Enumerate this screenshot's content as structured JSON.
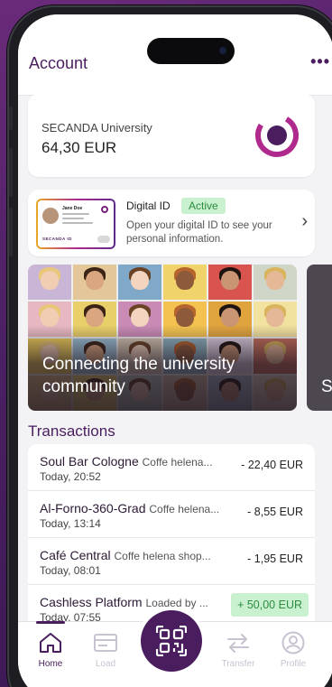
{
  "header": {
    "title": "Account",
    "more": "•••"
  },
  "balance": {
    "organization": "SECANDA University",
    "amount": "64,30 EUR"
  },
  "digital_id": {
    "label": "Digital ID",
    "status": "Active",
    "description": "Open your digital ID to see your personal information.",
    "card_name": "Jane Doe",
    "card_brand": "SECANDA ID"
  },
  "banners": [
    {
      "text": "Connecting the university community"
    },
    {
      "text": "S f"
    }
  ],
  "transactions": {
    "title": "Transactions",
    "items": [
      {
        "merchant": "Soul Bar Cologne",
        "detail": "Coffe helena...",
        "time": "Today, 20:52",
        "amount": "- 22,40 EUR",
        "positive": false
      },
      {
        "merchant": "Al-Forno-360-Grad",
        "detail": "Coffe helena...",
        "time": "Today, 13:14",
        "amount": "- 8,55 EUR",
        "positive": false
      },
      {
        "merchant": "Café Central",
        "detail": "Coffe helena shop...",
        "time": "Today, 08:01",
        "amount": "- 1,95 EUR",
        "positive": false
      },
      {
        "merchant": "Cashless Platform",
        "detail": "Loaded by ...",
        "time": "Today, 07:55",
        "amount": "+ 50,00 EUR",
        "positive": true
      }
    ]
  },
  "tabs": [
    {
      "label": "Home",
      "icon": "home-icon",
      "active": true
    },
    {
      "label": "Load",
      "icon": "card-icon",
      "active": false
    },
    {
      "label": "Transfer",
      "icon": "transfer-icon",
      "active": false
    },
    {
      "label": "Profile",
      "icon": "profile-icon",
      "active": false
    }
  ],
  "colors": {
    "brand": "#4a1d5e",
    "accent": "#b02a8d",
    "positive_bg": "#c9f1cf",
    "positive_text": "#2c8c40"
  }
}
